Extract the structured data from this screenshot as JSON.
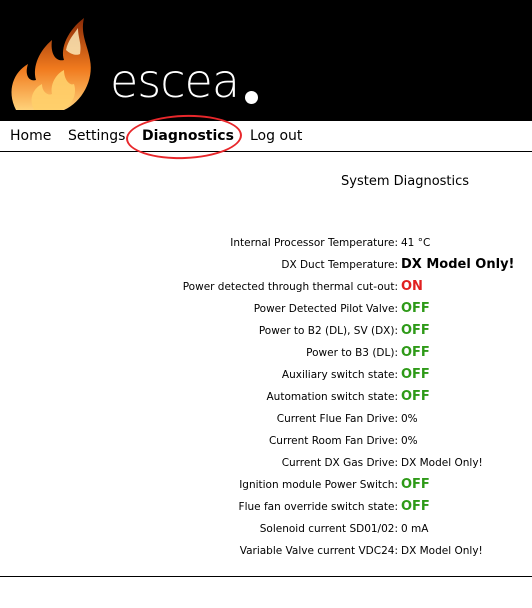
{
  "brand": {
    "logo_text": "escea"
  },
  "nav": {
    "items": [
      {
        "label": "Home"
      },
      {
        "label": "Settings"
      },
      {
        "label": "Diagnostics"
      },
      {
        "label": "Log out"
      }
    ],
    "active": "Diagnostics"
  },
  "page": {
    "title": "System Diagnostics"
  },
  "diagnostics": [
    {
      "label": "Internal Processor Temperature:",
      "value": "41 °C",
      "style": "plain"
    },
    {
      "label": "DX Duct Temperature:",
      "value": "DX Model Only!",
      "style": "bold"
    },
    {
      "label": "Power detected through thermal cut-out:",
      "value": "ON",
      "style": "on"
    },
    {
      "label": "Power Detected Pilot Valve:",
      "value": "OFF",
      "style": "off"
    },
    {
      "label": "Power to B2 (DL), SV (DX):",
      "value": "OFF",
      "style": "off"
    },
    {
      "label": "Power to B3 (DL):",
      "value": "OFF",
      "style": "off"
    },
    {
      "label": "Auxiliary switch state:",
      "value": "OFF",
      "style": "off"
    },
    {
      "label": "Automation switch state:",
      "value": "OFF",
      "style": "off"
    },
    {
      "label": "Current Flue Fan Drive:",
      "value": "0%",
      "style": "plain"
    },
    {
      "label": "Current Room Fan Drive:",
      "value": "0%",
      "style": "plain"
    },
    {
      "label": "Current DX Gas Drive:",
      "value": "DX Model Only!",
      "style": "plain"
    },
    {
      "label": "Ignition module Power Switch:",
      "value": "OFF",
      "style": "off"
    },
    {
      "label": "Flue fan override switch state:",
      "value": "OFF",
      "style": "off"
    },
    {
      "label": "Solenoid current SD01/02:",
      "value": "0 mA",
      "style": "plain"
    },
    {
      "label": "Variable Valve current VDC24:",
      "value": "DX Model Only!",
      "style": "plain"
    }
  ],
  "colors": {
    "on": "#e02020",
    "off": "#2e9a18",
    "highlight_circle": "#e8272b",
    "header_bg": "#000000"
  }
}
